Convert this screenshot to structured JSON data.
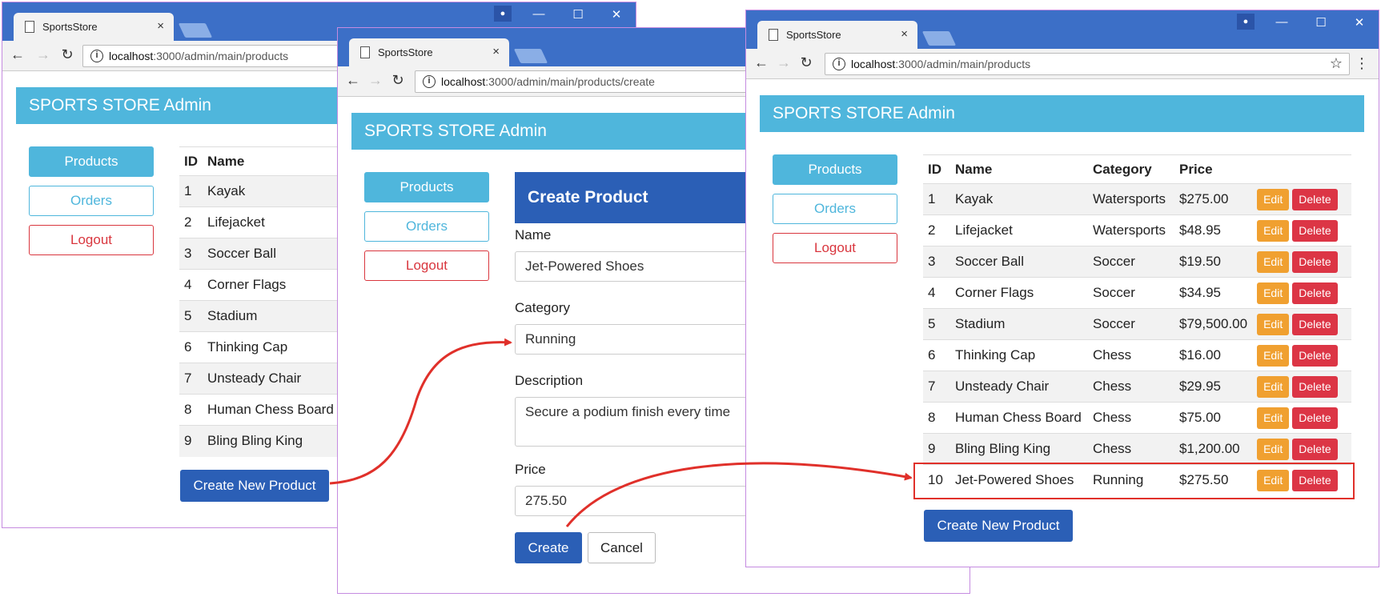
{
  "colors": {
    "banner": "#4fb6dc",
    "primary": "#2b5fb6",
    "danger": "#dc3545",
    "warning": "#f0a030",
    "arrow": "#e0302a"
  },
  "browser": {
    "tab_title": "SportsStore",
    "url_host": "localhost",
    "tab_close": "×"
  },
  "icons": {
    "back": "back-arrow-icon",
    "forward": "forward-arrow-icon",
    "reload": "reload-icon",
    "info": "info-icon",
    "star": "bookmark-star-icon",
    "menu": "menu-dots-icon"
  },
  "app": {
    "brand": "SPORTS STORE Admin"
  },
  "sidebar": {
    "products": "Products",
    "orders": "Orders",
    "logout": "Logout"
  },
  "window1": {
    "url_path": ":3000/admin/main/products",
    "columns": [
      "ID",
      "Name"
    ],
    "rows": [
      [
        "1",
        "Kayak"
      ],
      [
        "2",
        "Lifejacket"
      ],
      [
        "3",
        "Soccer Ball"
      ],
      [
        "4",
        "Corner Flags"
      ],
      [
        "5",
        "Stadium"
      ],
      [
        "6",
        "Thinking Cap"
      ],
      [
        "7",
        "Unsteady Chair"
      ],
      [
        "8",
        "Human Chess Board"
      ],
      [
        "9",
        "Bling Bling King"
      ]
    ],
    "create_button": "Create New Product"
  },
  "window2": {
    "url_path": ":3000/admin/main/products/create",
    "form_title": "Create Product",
    "fields": {
      "name_label": "Name",
      "name_value": "Jet-Powered Shoes",
      "category_label": "Category",
      "category_value": "Running",
      "description_label": "Description",
      "description_value": "Secure a podium finish every time",
      "price_label": "Price",
      "price_value": "275.50"
    },
    "create_button": "Create",
    "cancel_button": "Cancel"
  },
  "window3": {
    "url_path": ":3000/admin/main/products",
    "columns": [
      "ID",
      "Name",
      "Category",
      "Price",
      ""
    ],
    "rows": [
      [
        "1",
        "Kayak",
        "Watersports",
        "$275.00"
      ],
      [
        "2",
        "Lifejacket",
        "Watersports",
        "$48.95"
      ],
      [
        "3",
        "Soccer Ball",
        "Soccer",
        "$19.50"
      ],
      [
        "4",
        "Corner Flags",
        "Soccer",
        "$34.95"
      ],
      [
        "5",
        "Stadium",
        "Soccer",
        "$79,500.00"
      ],
      [
        "6",
        "Thinking Cap",
        "Chess",
        "$16.00"
      ],
      [
        "7",
        "Unsteady Chair",
        "Chess",
        "$29.95"
      ],
      [
        "8",
        "Human Chess Board",
        "Chess",
        "$75.00"
      ],
      [
        "9",
        "Bling Bling King",
        "Chess",
        "$1,200.00"
      ],
      [
        "10",
        "Jet-Powered Shoes",
        "Running",
        "$275.50"
      ]
    ],
    "edit_label": "Edit",
    "delete_label": "Delete",
    "create_button": "Create New Product"
  }
}
